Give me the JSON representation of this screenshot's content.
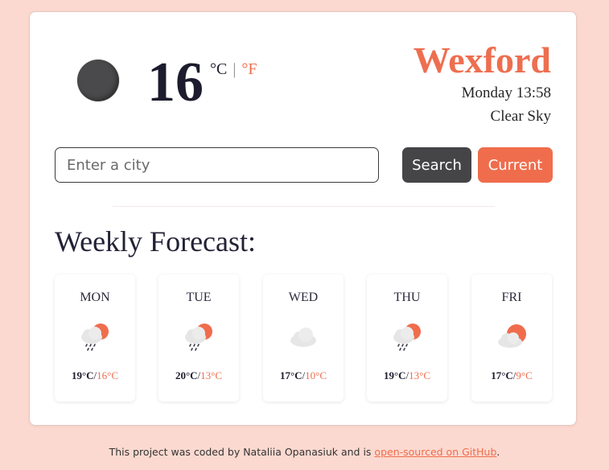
{
  "current": {
    "temperature": "16",
    "unit_c": "°C",
    "unit_sep": "|",
    "unit_f": "°F",
    "city": "Wexford",
    "datetime": "Monday 13:58",
    "description": "Clear Sky",
    "icon": "night-moon-icon"
  },
  "search": {
    "placeholder": "Enter a city",
    "button_label": "Search",
    "current_label": "Current"
  },
  "weekly": {
    "title": "Weekly Forecast:",
    "days": [
      {
        "name": "MON",
        "hi": "19°C",
        "sep": "/",
        "lo": "16°C",
        "icon": "rain-sun-cloud-icon"
      },
      {
        "name": "TUE",
        "hi": "20°C",
        "sep": "/",
        "lo": "13°C",
        "icon": "rain-sun-cloud-icon"
      },
      {
        "name": "WED",
        "hi": "17°C",
        "sep": "/",
        "lo": "10°C",
        "icon": "cloud-icon"
      },
      {
        "name": "THU",
        "hi": "19°C",
        "sep": "/",
        "lo": "13°C",
        "icon": "rain-sun-cloud-icon"
      },
      {
        "name": "FRI",
        "hi": "17°C",
        "sep": "/",
        "lo": "9°C",
        "icon": "sun-cloud-icon"
      }
    ]
  },
  "footer": {
    "text_before": "This project was coded by Nataliia Opanasiuk and is ",
    "link_text": "open-sourced on GitHub",
    "text_after": "."
  },
  "colors": {
    "background": "#fcd9d0",
    "accent": "#ef6d4d",
    "dark_button": "#454548"
  }
}
